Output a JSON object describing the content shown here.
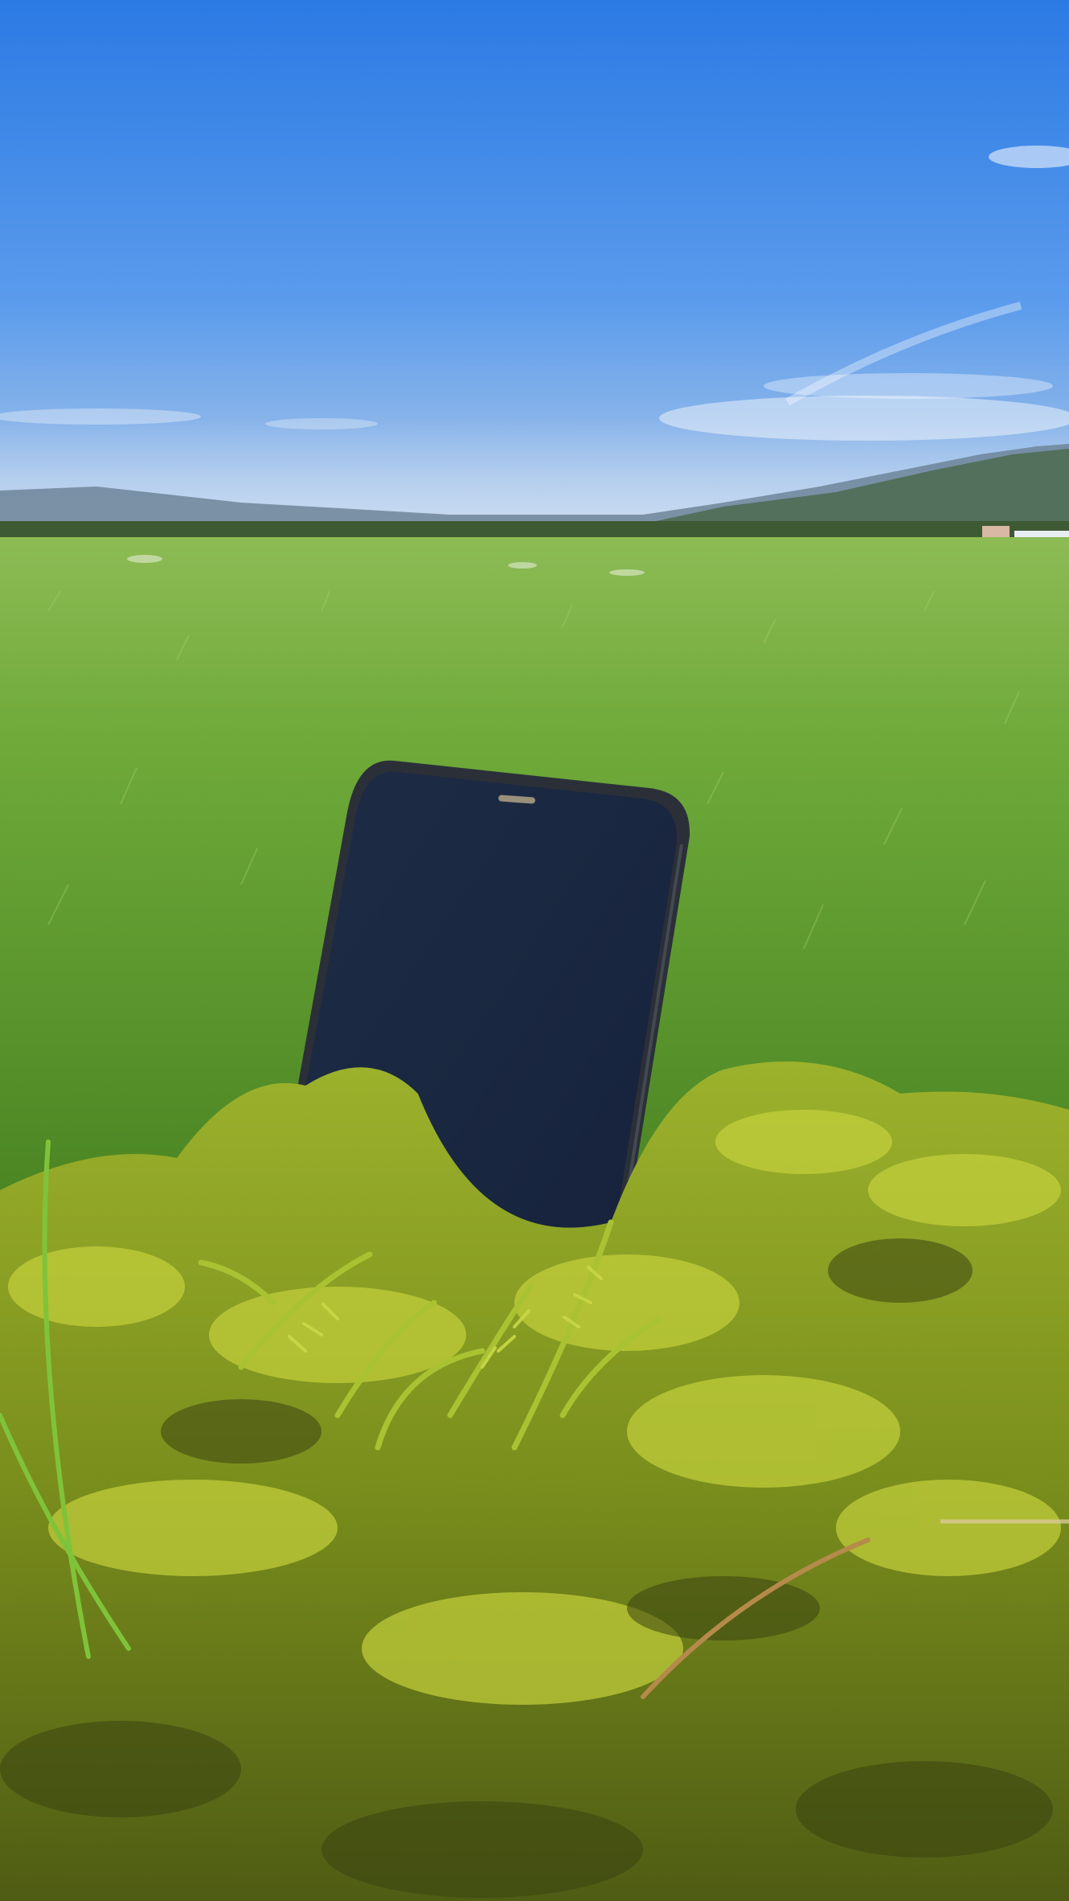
{
  "scene": {
    "subject": "phone",
    "palette": {
      "sky_top": "#2f7fe6",
      "sky_mid": "#5e9cec",
      "sky_horizon": "#aac6ea",
      "mountain": "#4f6a5a",
      "far_field": "#7fae4a",
      "lawn": "#5c9a2c",
      "lawn_light": "#8cc24a",
      "moss": "#7d9a1e",
      "moss_light": "#b6c83a",
      "moss_dark": "#3c4a12",
      "phone_body": "#1a1f26",
      "phone_screen": "#1c2a42",
      "phone_frame": "#2b3038"
    }
  }
}
